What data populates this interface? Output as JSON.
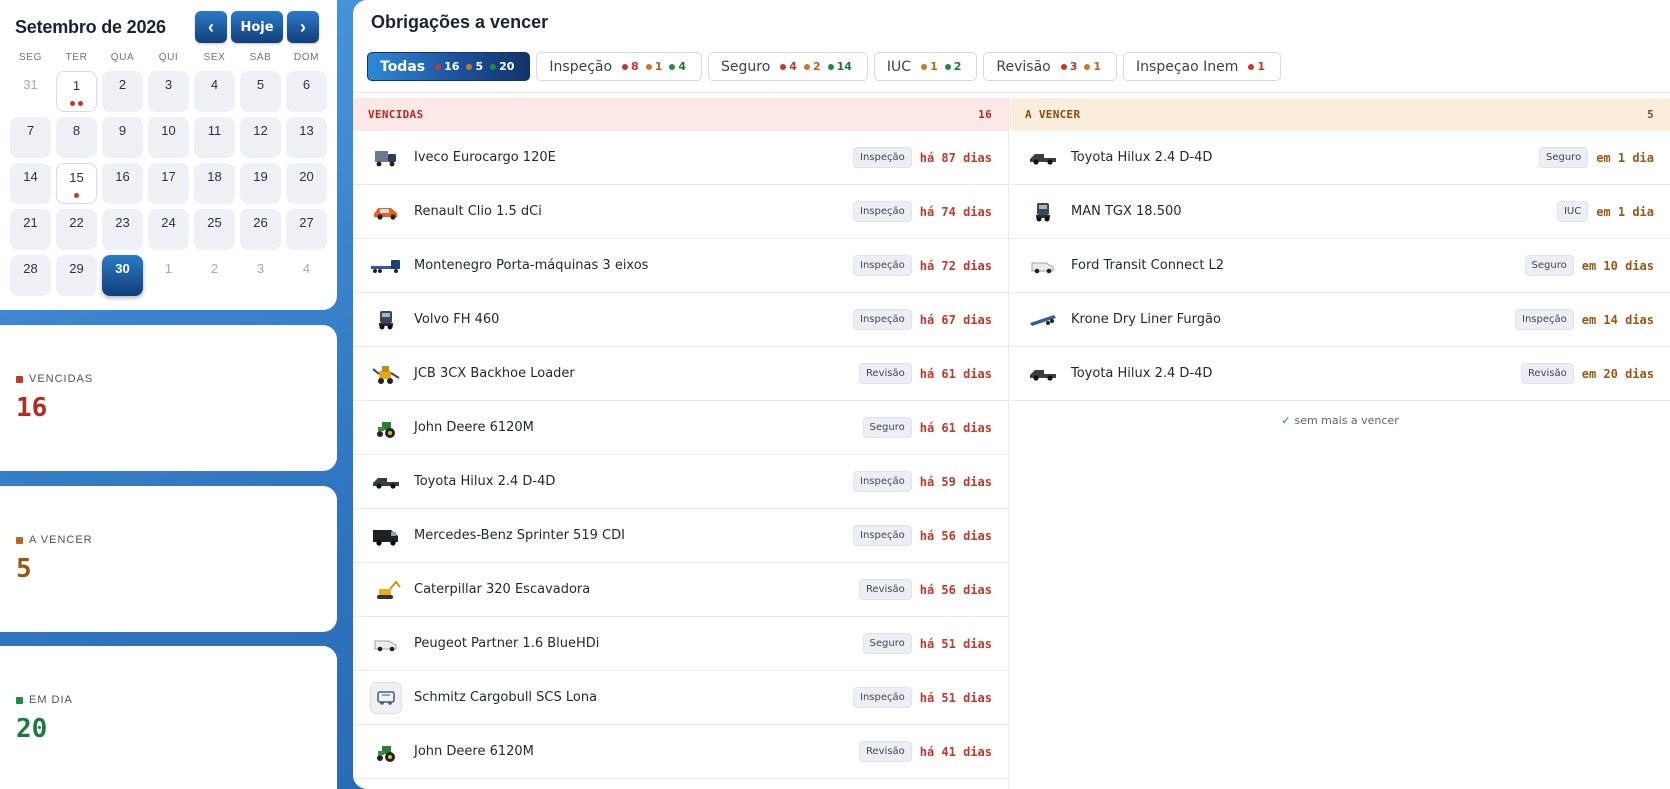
{
  "calendar": {
    "title": "Setembro de 2026",
    "prev_label": "‹",
    "today_label": "Hoje",
    "next_label": "›",
    "weekdays": [
      "SEG",
      "TER",
      "QUA",
      "QUI",
      "SEX",
      "SÁB",
      "DOM"
    ],
    "days": [
      {
        "n": "31",
        "out": true
      },
      {
        "n": "1",
        "marked": true,
        "dots": 2
      },
      {
        "n": "2"
      },
      {
        "n": "3"
      },
      {
        "n": "4"
      },
      {
        "n": "5"
      },
      {
        "n": "6"
      },
      {
        "n": "7"
      },
      {
        "n": "8"
      },
      {
        "n": "9"
      },
      {
        "n": "10"
      },
      {
        "n": "11"
      },
      {
        "n": "12"
      },
      {
        "n": "13"
      },
      {
        "n": "14"
      },
      {
        "n": "15",
        "marked": true,
        "dots": 1
      },
      {
        "n": "16"
      },
      {
        "n": "17"
      },
      {
        "n": "18"
      },
      {
        "n": "19"
      },
      {
        "n": "20"
      },
      {
        "n": "21"
      },
      {
        "n": "22"
      },
      {
        "n": "23"
      },
      {
        "n": "24"
      },
      {
        "n": "25"
      },
      {
        "n": "26"
      },
      {
        "n": "27"
      },
      {
        "n": "28"
      },
      {
        "n": "29"
      },
      {
        "n": "30",
        "selected": true
      },
      {
        "n": "1",
        "out": true
      },
      {
        "n": "2",
        "out": true
      },
      {
        "n": "3",
        "out": true
      },
      {
        "n": "4",
        "out": true
      }
    ]
  },
  "stats": {
    "vencidas": {
      "label": "VENCIDAS",
      "value": "16",
      "color": "#b52a24"
    },
    "a_vencer": {
      "label": "A VENCER",
      "value": "5",
      "color": "#9a5612"
    },
    "em_dia": {
      "label": "EM DIA",
      "value": "20",
      "color": "#1e7a3c"
    }
  },
  "main": {
    "title": "Obrigações a vencer",
    "filters": [
      {
        "name": "Todas",
        "active": true,
        "counts": [
          {
            "c": "red",
            "v": "16"
          },
          {
            "c": "orange",
            "v": "5"
          },
          {
            "c": "green",
            "v": "20"
          }
        ]
      },
      {
        "name": "Inspeção",
        "counts": [
          {
            "c": "red",
            "v": "8"
          },
          {
            "c": "orange",
            "v": "1"
          },
          {
            "c": "green",
            "v": "4"
          }
        ]
      },
      {
        "name": "Seguro",
        "counts": [
          {
            "c": "red",
            "v": "4"
          },
          {
            "c": "orange",
            "v": "2"
          },
          {
            "c": "green",
            "v": "14"
          }
        ]
      },
      {
        "name": "IUC",
        "counts": [
          {
            "c": "orange",
            "v": "1"
          },
          {
            "c": "green",
            "v": "2"
          }
        ]
      },
      {
        "name": "Revisão",
        "counts": [
          {
            "c": "red",
            "v": "3"
          },
          {
            "c": "orange",
            "v": "1"
          }
        ]
      },
      {
        "name": "Inspeçao Inem",
        "counts": [
          {
            "c": "red",
            "v": "1"
          }
        ]
      }
    ],
    "overdue": {
      "title": "VENCIDAS",
      "count": "16",
      "rows": [
        {
          "icon": "truck-icon",
          "name": "Iveco Eurocargo 120E",
          "tag": "Inspeção",
          "due": "há 87 dias"
        },
        {
          "icon": "car-orange-icon",
          "name": "Renault Clio 1.5 dCi",
          "tag": "Inspeção",
          "due": "há 74 dias"
        },
        {
          "icon": "lowloader-icon",
          "name": "Montenegro Porta-máquinas 3 eixos",
          "tag": "Inspeção",
          "due": "há 72 dias"
        },
        {
          "icon": "tractor-unit-icon",
          "name": "Volvo FH 460",
          "tag": "Inspeção",
          "due": "há 67 dias"
        },
        {
          "icon": "backhoe-icon",
          "name": "JCB 3CX Backhoe Loader",
          "tag": "Revisão",
          "due": "há 61 dias"
        },
        {
          "icon": "tractor-icon",
          "name": "John Deere 6120M",
          "tag": "Seguro",
          "due": "há 61 dias"
        },
        {
          "icon": "pickup-icon",
          "name": "Toyota Hilux 2.4 D-4D",
          "tag": "Inspeção",
          "due": "há 59 dias"
        },
        {
          "icon": "van-icon",
          "name": "Mercedes-Benz Sprinter 519 CDI",
          "tag": "Inspeção",
          "due": "há 56 dias"
        },
        {
          "icon": "excavator-icon",
          "name": "Caterpillar 320 Escavadora",
          "tag": "Revisão",
          "due": "há 56 dias"
        },
        {
          "icon": "small-van-icon",
          "name": "Peugeot Partner 1.6 BlueHDi",
          "tag": "Seguro",
          "due": "há 51 dias"
        },
        {
          "icon": "trailer-icon",
          "name": "Schmitz Cargobull SCS Lona",
          "tag": "Inspeção",
          "due": "há 51 dias"
        },
        {
          "icon": "tractor-icon",
          "name": "John Deere 6120M",
          "tag": "Revisão",
          "due": "há 41 dias"
        }
      ]
    },
    "upcoming": {
      "title": "A VENCER",
      "count": "5",
      "rows": [
        {
          "icon": "pickup-icon",
          "name": "Toyota Hilux 2.4 D-4D",
          "tag": "Seguro",
          "due": "em 1 dia"
        },
        {
          "icon": "tractor-unit-icon",
          "name": "MAN TGX 18.500",
          "tag": "IUC",
          "due": "em 1 dia"
        },
        {
          "icon": "small-van-icon",
          "name": "Ford Transit Connect L2",
          "tag": "Seguro",
          "due": "em 10 dias"
        },
        {
          "icon": "semi-trailer-icon",
          "name": "Krone Dry Liner Furgão",
          "tag": "Inspeção",
          "due": "em 14 dias"
        },
        {
          "icon": "pickup-icon",
          "name": "Toyota Hilux 2.4 D-4D",
          "tag": "Revisão",
          "due": "em 20 dias"
        }
      ],
      "empty_note": "sem mais a vencer"
    }
  }
}
